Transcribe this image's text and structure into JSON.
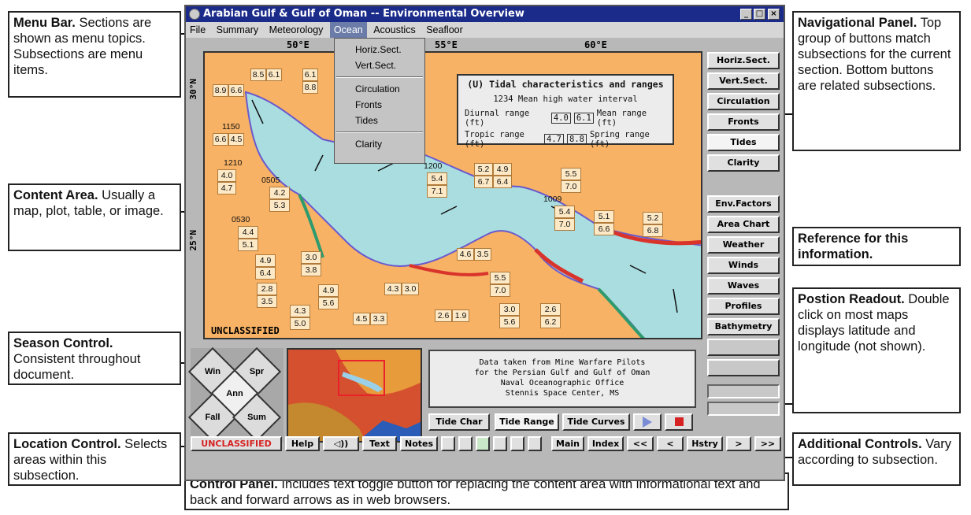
{
  "window": {
    "title": "Arabian Gulf & Gulf of Oman -- Environmental Overview",
    "min": "_",
    "max": "□",
    "close": "×"
  },
  "menu": [
    "File",
    "Summary",
    "Meteorology",
    "Ocean",
    "Acoustics",
    "Seafloor"
  ],
  "dropdown": [
    "Horiz.Sect.",
    "Vert.Sect.",
    "Circulation",
    "Fronts",
    "Tides",
    "Clarity"
  ],
  "map": {
    "longitudes": [
      "50°E",
      "55°E",
      "60°E"
    ],
    "latitudes": [
      "30°N",
      "25°N"
    ],
    "classification": "UNCLASSIFIED",
    "tide_box": {
      "title": "(U) Tidal characteristics and ranges",
      "legend_line1": "1234 Mean high water interval",
      "diurnal": "Diurnal range (ft)",
      "mean": "Mean range (ft)",
      "tropic": "Tropic range (ft)",
      "spring": "Spring range (ft)",
      "v1": "4.0",
      "v2": "6.1",
      "v3": "4.7",
      "v4": "8.8"
    },
    "stations": [
      {
        "a": "8.5",
        "b": "6.1"
      },
      {
        "a": "6.1",
        "b": "8.8"
      },
      {
        "a": "8.9",
        "b": "6.6"
      },
      {
        "a": "6.6",
        "b": "4.5",
        "h": "1150"
      },
      {
        "a": "4.0",
        "b": "4.7",
        "h": "1210"
      },
      {
        "a": "4.2",
        "b": "5.3",
        "h": "0505"
      },
      {
        "a": "4.4",
        "b": "5.1",
        "h": "0530"
      },
      {
        "a": "4.9",
        "b": "6.4"
      },
      {
        "a": "3.0",
        "b": "3.8"
      },
      {
        "a": "2.8",
        "b": "3.5"
      },
      {
        "a": "4.9",
        "b": "5.6"
      },
      {
        "a": "4.3",
        "b": "5.0"
      },
      {
        "a": "4.5",
        "b": "3.3"
      },
      {
        "a": "4.3",
        "b": "3.0"
      },
      {
        "a": "2.6",
        "b": "1.9"
      },
      {
        "a": "4.6",
        "b": "3.5"
      },
      {
        "a": "5.5",
        "b": "7.0"
      },
      {
        "a": "3.0",
        "b": "5.6"
      },
      {
        "a": "2.6",
        "b": "6.2"
      },
      {
        "a": "5.4",
        "b": "7.1",
        "h": "1200"
      },
      {
        "a": "5.2",
        "b": "6.7"
      },
      {
        "a": "4.9",
        "b": "6.4"
      },
      {
        "a": "5.5",
        "b": "7.0"
      },
      {
        "a": "5.4",
        "b": "7.0",
        "h": "1009"
      },
      {
        "a": "5.1",
        "b": "6.6"
      },
      {
        "a": "5.2",
        "b": "6.8"
      }
    ]
  },
  "nav_top": [
    "Horiz.Sect.",
    "Vert.Sect.",
    "Circulation",
    "Fronts",
    "Tides",
    "Clarity"
  ],
  "nav_bottom": [
    "Env.Factors",
    "Area Chart",
    "Weather",
    "Winds",
    "Waves",
    "Profiles",
    "Bathymetry"
  ],
  "season": {
    "win": "Win",
    "spr": "Spr",
    "ann": "Ann",
    "fall": "Fall",
    "sum": "Sum"
  },
  "reference": [
    "Data taken from Mine Warfare Pilots",
    "for the Persian Gulf and Gulf of Oman",
    "Naval Oceanographic Office",
    "Stennis Space Center, MS"
  ],
  "tide_buttons": [
    "Tide Char",
    "Tide Range",
    "Tide Curves"
  ],
  "control": {
    "unclass": "UNCLASSIFIED",
    "help": "Help",
    "sound": "◁))",
    "text": "Text",
    "notes": "Notes",
    "main": "Main",
    "index": "Index",
    "first": "<<",
    "back": "<",
    "history": "Hstry",
    "fwd": ">",
    "last": ">>"
  },
  "callouts": {
    "menubar_title": "Menu Bar.",
    "menubar_text": " Sections are shown as menu topics. Subsections are menu items.",
    "content_title": "Content Area.",
    "content_text": " Usually a map, plot, table, or image.",
    "season_title": "Season Control.",
    "season_text": " Consistent throughout document.",
    "location_title": "Location Control.",
    "location_text": " Selects areas within this subsection.",
    "nav_title": "Navigational Panel.",
    "nav_text": " Top group of buttons match subsections for the current section. Bottom buttons are related subsections.",
    "ref_title": "Reference for this information.",
    "pos_title": "Postion Readout.",
    "pos_text": " Double click on most maps displays latitude and longitude (not shown).",
    "add_title": "Additional Controls.",
    "add_text": " Vary according to subsection.",
    "cp_title": "Control Panel.",
    "cp_text": " Includes text toggle button for replacing the content area with informational text and back and forward arrows as in web browsers."
  }
}
